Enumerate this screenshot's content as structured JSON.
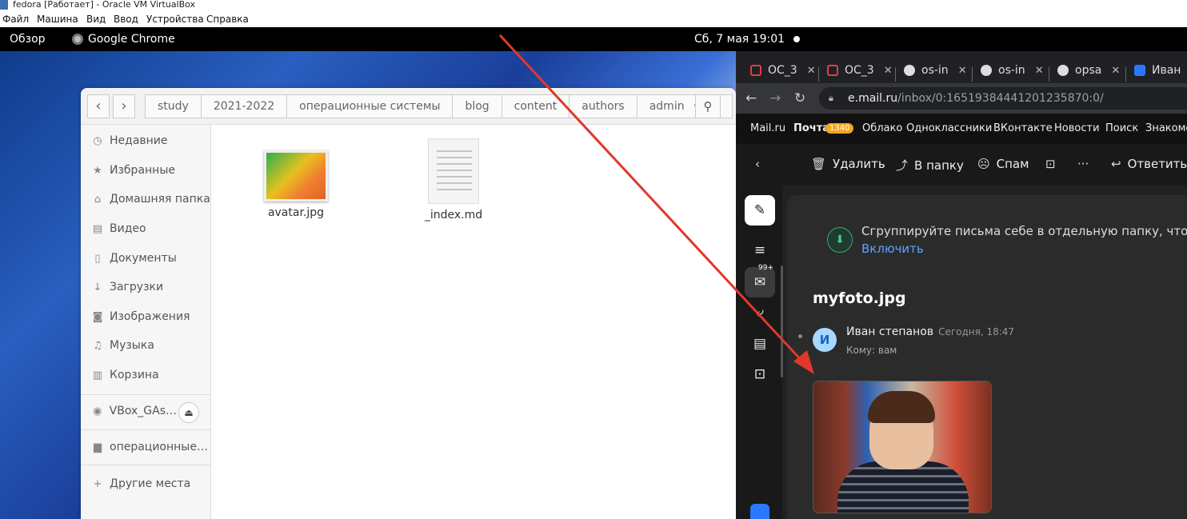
{
  "vbox": {
    "title": "fedora [Работает] - Oracle VM VirtualBox",
    "menu": [
      "Файл",
      "Машина",
      "Вид",
      "Ввод",
      "Устройства",
      "Справка"
    ]
  },
  "topbar": {
    "overview": "Обзор",
    "app_name": "Google Chrome",
    "clock": "Сб, 7 мая  19:01"
  },
  "files": {
    "path": [
      "study",
      "2021-2022",
      "операционные системы",
      "blog",
      "content",
      "authors",
      "admin"
    ],
    "sidebar": [
      {
        "icon": "clock-icon",
        "label": "Недавние"
      },
      {
        "icon": "star-icon",
        "label": "Избранные"
      },
      {
        "icon": "home-icon",
        "label": "Домашняя папка"
      },
      {
        "icon": "video-icon",
        "label": "Видео"
      },
      {
        "icon": "document-icon",
        "label": "Документы"
      },
      {
        "icon": "download-icon",
        "label": "Загрузки"
      },
      {
        "icon": "camera-icon",
        "label": "Изображения"
      },
      {
        "icon": "music-icon",
        "label": "Музыка"
      },
      {
        "icon": "trash-icon",
        "label": "Корзина"
      },
      {
        "icon": "disc-icon",
        "label": "VBox_GAs…"
      },
      {
        "icon": "folder-icon",
        "label": "операционные…"
      },
      {
        "icon": "plus-icon",
        "label": "Другие места"
      }
    ],
    "items": [
      {
        "name": "avatar.jpg",
        "kind": "image"
      },
      {
        "name": "_index.md",
        "kind": "text"
      }
    ]
  },
  "chrome": {
    "tabs": [
      {
        "label": "ОС_3",
        "icon": "mail-icon"
      },
      {
        "label": "ОС_3",
        "icon": "mail-icon"
      },
      {
        "label": "os-in",
        "icon": "github-icon"
      },
      {
        "label": "os-in",
        "icon": "github-icon"
      },
      {
        "label": "opsa",
        "icon": "github-icon"
      },
      {
        "label": "Иван",
        "icon": "vk-icon"
      }
    ],
    "url_host": "e.mail.ru",
    "url_path": "/inbox/0:16519384441201235870:0/"
  },
  "mail": {
    "portal_links": [
      "Mail.ru",
      "Почта",
      "Облако",
      "Одноклассники",
      "ВКонтакте",
      "Новости",
      "Поиск",
      "Знакомства"
    ],
    "unread_badge": "1340",
    "actions": {
      "delete": "Удалить",
      "move": "В папку",
      "spam": "Спам",
      "reply": "Ответить"
    },
    "rail_badge": "99+",
    "promo_text": "Сгруппируйте письма себе в отдельную папку, чтобы они",
    "promo_link": "Включить",
    "subject": "myfoto.jpg",
    "sender_initial": "И",
    "sender_name": "Иван степанов",
    "date": "Сегодня, 18:47",
    "recipient": "Кому:  вам"
  },
  "colors": {
    "annotation_arrow": "#e0382c",
    "mail_badge": "#f5a623",
    "link": "#5aa3ff"
  }
}
